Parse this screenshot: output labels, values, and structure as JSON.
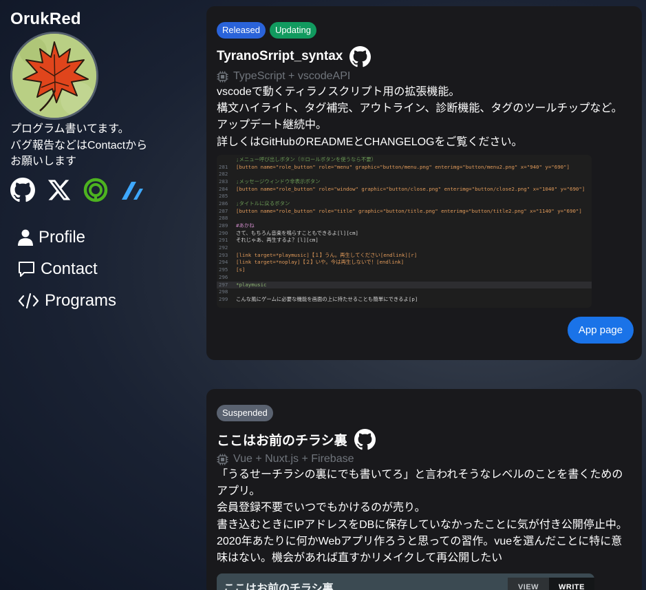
{
  "sidebar": {
    "site_title": "OrukRed",
    "bio": [
      "プログラム書いてます。",
      "バグ報告などはContactから",
      "お願いします"
    ],
    "social": [
      {
        "icon": "github-icon"
      },
      {
        "icon": "x-icon"
      },
      {
        "icon": "misskey-icon",
        "color": "#4db320"
      },
      {
        "icon": "zenn-icon",
        "color": "#3ea8ff"
      }
    ],
    "nav": [
      {
        "label": "Profile",
        "icon": "person-icon"
      },
      {
        "label": "Contact",
        "icon": "chat-icon"
      },
      {
        "label": "Programs",
        "icon": "code-icon"
      }
    ]
  },
  "projects": [
    {
      "badges": [
        "Released",
        "Updating"
      ],
      "title": "TyranoSrript_syntax",
      "tech": "TypeScript + vscodeAPI",
      "description": [
        "vscodeで動くティラノスクリプト用の拡張機能。",
        "構文ハイライト、タグ補完、アウトライン、診断機能、タグのツールチップなど。",
        "アップデート継続中。",
        "詳しくはGitHubのREADMEとCHANGELOGをご覧ください。"
      ],
      "code_lines": [
        {
          "n": "",
          "t": ";メニュー呼び出しボタン（※ロールボタンを使うなら不要）"
        },
        {
          "n": "281",
          "t": "[button name=\"role_button\" role=\"menu\" graphic=\"button/menu.png\" enterimg=\"button/menu2.png\" x=\"940\" y=\"690\"]"
        },
        {
          "n": "282",
          "t": ""
        },
        {
          "n": "283",
          "t": ";メッセージウィンドウ非表示ボタン"
        },
        {
          "n": "284",
          "t": "[button name=\"role_button\" role=\"window\" graphic=\"button/close.png\" enterimg=\"button/close2.png\" x=\"1040\" y=\"690\"]"
        },
        {
          "n": "285",
          "t": ""
        },
        {
          "n": "286",
          "t": ";タイトルに戻るボタン"
        },
        {
          "n": "287",
          "t": "[button name=\"role_button\" role=\"title\" graphic=\"button/title.png\" enterimg=\"button/title2.png\" x=\"1140\" y=\"690\"]"
        },
        {
          "n": "288",
          "t": ""
        },
        {
          "n": "289",
          "t": "#あかね"
        },
        {
          "n": "290",
          "t": "さて、もちろん音楽を鳴らすこともできるよ[l][cm]"
        },
        {
          "n": "291",
          "t": "それじゃあ、再生するよ？[l][cm]"
        },
        {
          "n": "292",
          "t": ""
        },
        {
          "n": "293",
          "t": "[link target=*playmusic]【１】うん。再生してください[endlink][r]"
        },
        {
          "n": "294",
          "t": "[link target=*noplay]【２】いや。今は再生しないで！[endlink]"
        },
        {
          "n": "295",
          "t": "[s]"
        },
        {
          "n": "296",
          "t": ""
        },
        {
          "n": "297",
          "t": "*playmusic"
        },
        {
          "n": "298",
          "t": ""
        },
        {
          "n": "299",
          "t": "こんな風にゲームに必要な機能を画面の上に持たせることも簡単にできるよ[p]"
        }
      ],
      "button_label": "App page"
    },
    {
      "badges": [
        "Suspended"
      ],
      "title": "ここはお前のチラシ裏",
      "tech": "Vue + Nuxt.js + Firebase",
      "description": [
        "「うるせーチラシの裏にでも書いてろ」と言われそうなレベルのことを書くためのアプリ。",
        "会員登録不要でいつでもかけるのが売り。",
        "書き込むときにIPアドレスをDBに保存していなかったことに気が付き公開停止中。",
        "2020年あたりに何かWebアプリ作ろうと思っての習作。vueを選んだことに特に意味はない。機会があれば直すかリメイクして再公開したい"
      ],
      "preview": {
        "title": "ここはお前のチラシ裏",
        "tabs": [
          "VIEW",
          "WRITE"
        ]
      }
    }
  ],
  "colors": {
    "released": "#2a63d9",
    "updating": "#119a5f",
    "suspended": "#5a6270",
    "app_button": "#1a73e8",
    "card_bg": "#19191c"
  }
}
